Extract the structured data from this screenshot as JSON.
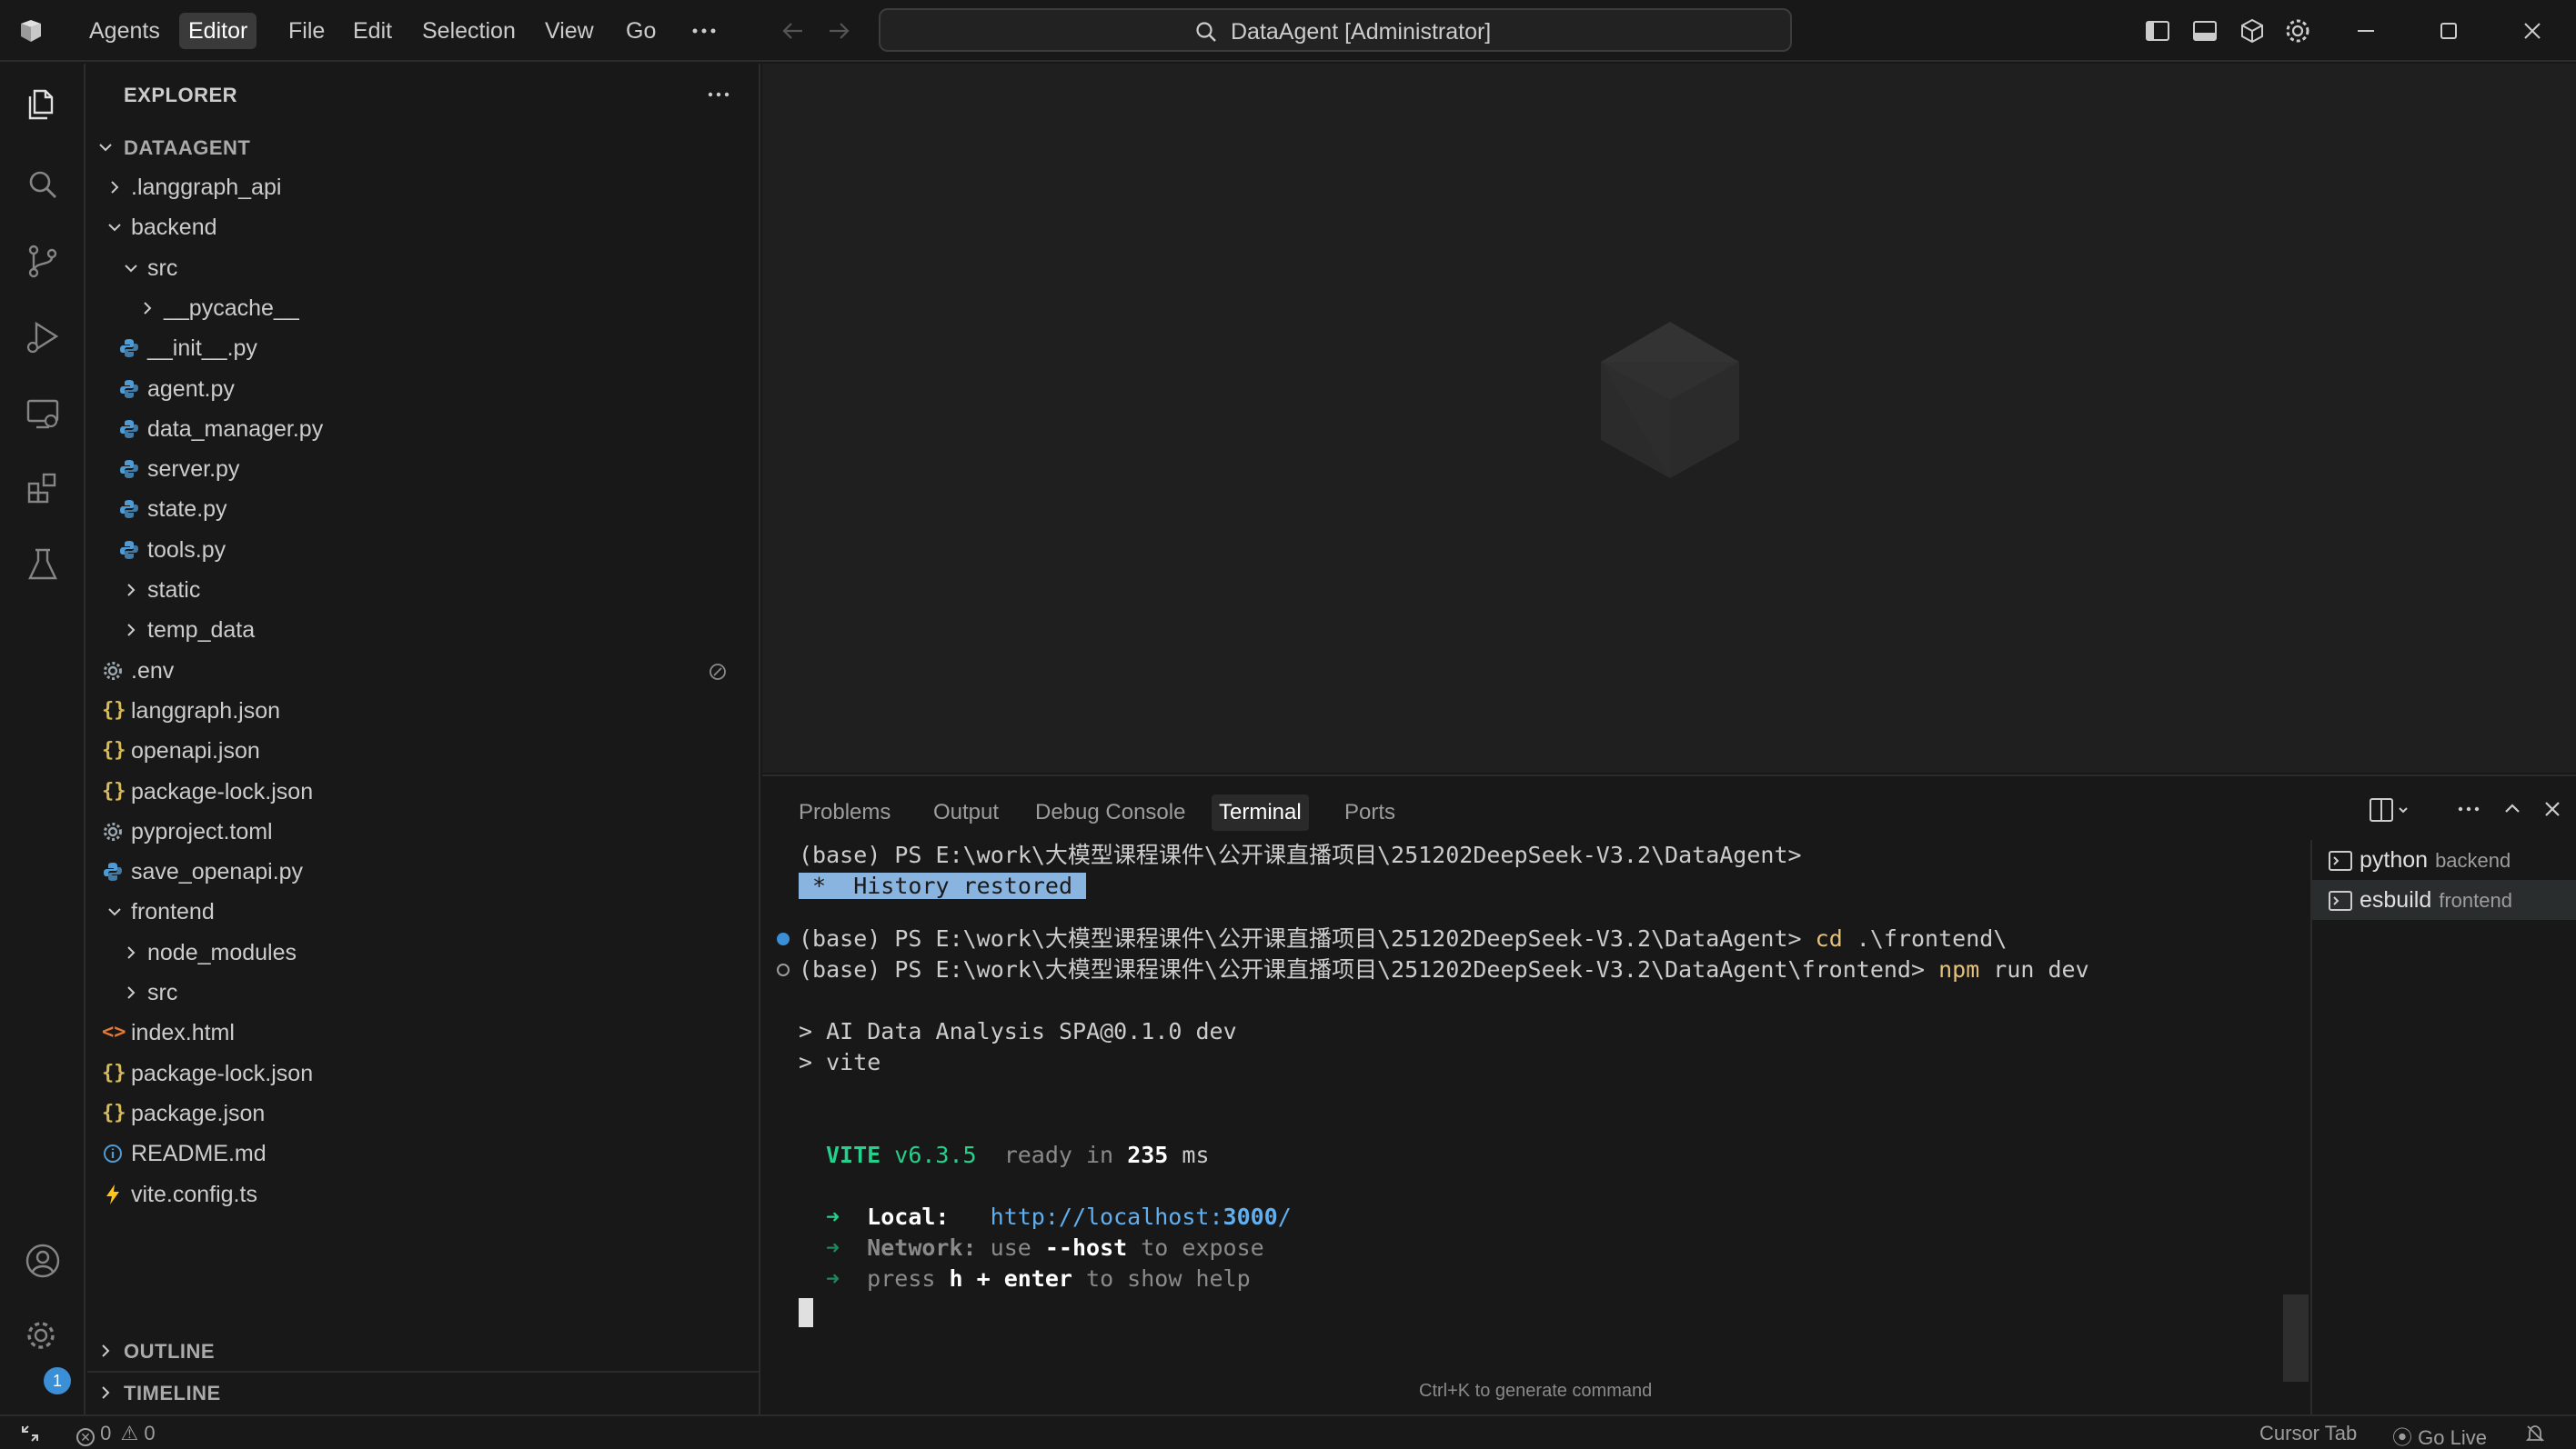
{
  "titlebar": {
    "menu": [
      "Agents",
      "Editor",
      "File",
      "Edit",
      "Selection",
      "View",
      "Go"
    ],
    "active_menu": "Editor",
    "search_text": "DataAgent [Administrator]"
  },
  "activity": {
    "settings_badge": "1"
  },
  "sidebar": {
    "title": "EXPLORER",
    "root": "DATAAGENT",
    "items": [
      {
        "label": ".langgraph_api",
        "type": "folder",
        "expanded": false
      },
      {
        "label": "backend",
        "type": "folder",
        "expanded": true
      },
      {
        "label": "src",
        "type": "folder",
        "expanded": true
      },
      {
        "label": "__pycache__",
        "type": "folder",
        "expanded": false
      },
      {
        "label": "__init__.py",
        "type": "python"
      },
      {
        "label": "agent.py",
        "type": "python"
      },
      {
        "label": "data_manager.py",
        "type": "python"
      },
      {
        "label": "server.py",
        "type": "python"
      },
      {
        "label": "state.py",
        "type": "python"
      },
      {
        "label": "tools.py",
        "type": "python"
      },
      {
        "label": "static",
        "type": "folder",
        "expanded": false
      },
      {
        "label": "temp_data",
        "type": "folder",
        "expanded": false
      },
      {
        "label": ".env",
        "type": "gear"
      },
      {
        "label": "langgraph.json",
        "type": "json"
      },
      {
        "label": "openapi.json",
        "type": "json"
      },
      {
        "label": "package-lock.json",
        "type": "json"
      },
      {
        "label": "pyproject.toml",
        "type": "gear"
      },
      {
        "label": "save_openapi.py",
        "type": "python"
      },
      {
        "label": "frontend",
        "type": "folder",
        "expanded": true
      },
      {
        "label": "node_modules",
        "type": "folder",
        "expanded": false
      },
      {
        "label": "src",
        "type": "folder",
        "expanded": false
      },
      {
        "label": "index.html",
        "type": "html"
      },
      {
        "label": "package-lock.json",
        "type": "json"
      },
      {
        "label": "package.json",
        "type": "json"
      },
      {
        "label": "README.md",
        "type": "info"
      },
      {
        "label": "vite.config.ts",
        "type": "vite"
      }
    ],
    "outline": "OUTLINE",
    "timeline": "TIMELINE"
  },
  "panel": {
    "tabs": [
      "Problems",
      "Output",
      "Debug Console",
      "Terminal",
      "Ports"
    ],
    "active_tab": "Terminal",
    "terminal": {
      "prompt1": "(base) PS E:\\work\\大模型课程课件\\公开课直播项目\\251202DeepSeek-V3.2\\DataAgent>",
      "history_badge": " *  History restored ",
      "prompt2": "(base) PS E:\\work\\大模型课程课件\\公开课直播项目\\251202DeepSeek-V3.2\\DataAgent>",
      "cmd2_name": "cd",
      "cmd2_arg": " .\\frontend\\",
      "prompt3": "(base) PS E:\\work\\大模型课程课件\\公开课直播项目\\251202DeepSeek-V3.2\\DataAgent\\frontend>",
      "cmd3_name": "npm",
      "cmd3_arg": " run dev",
      "script_line": "> AI Data Analysis SPA@0.1.0 dev",
      "vite_line": "> vite",
      "vite_name": "VITE",
      "vite_version": "v6.3.5",
      "ready_text": "ready in",
      "ready_ms": "235",
      "ms_unit": "ms",
      "arrow": "➜",
      "local_label": "Local:",
      "local_url_prefix": "http://localhost:",
      "local_port": "3000",
      "local_url_suffix": "/",
      "network_label": "Network:",
      "network_use": "use",
      "network_flag": "--host",
      "network_rest": "to expose",
      "press_text": "press",
      "press_keys": "h + enter",
      "press_rest": "to show help"
    },
    "hint": "Ctrl+K to generate command",
    "terminals": [
      {
        "name": "python",
        "desc": "backend"
      },
      {
        "name": "esbuild",
        "desc": "frontend"
      }
    ]
  },
  "statusbar": {
    "errors": "0",
    "warnings": "0",
    "cursor_tab": "Cursor Tab",
    "go_live": "Go Live"
  },
  "colors": {
    "accent": "#3a8fd6",
    "python_icon": "#4f9bd4",
    "json_icon": "#d7ba5a",
    "html_icon": "#e37933",
    "vite_icon": "#ffc517"
  }
}
